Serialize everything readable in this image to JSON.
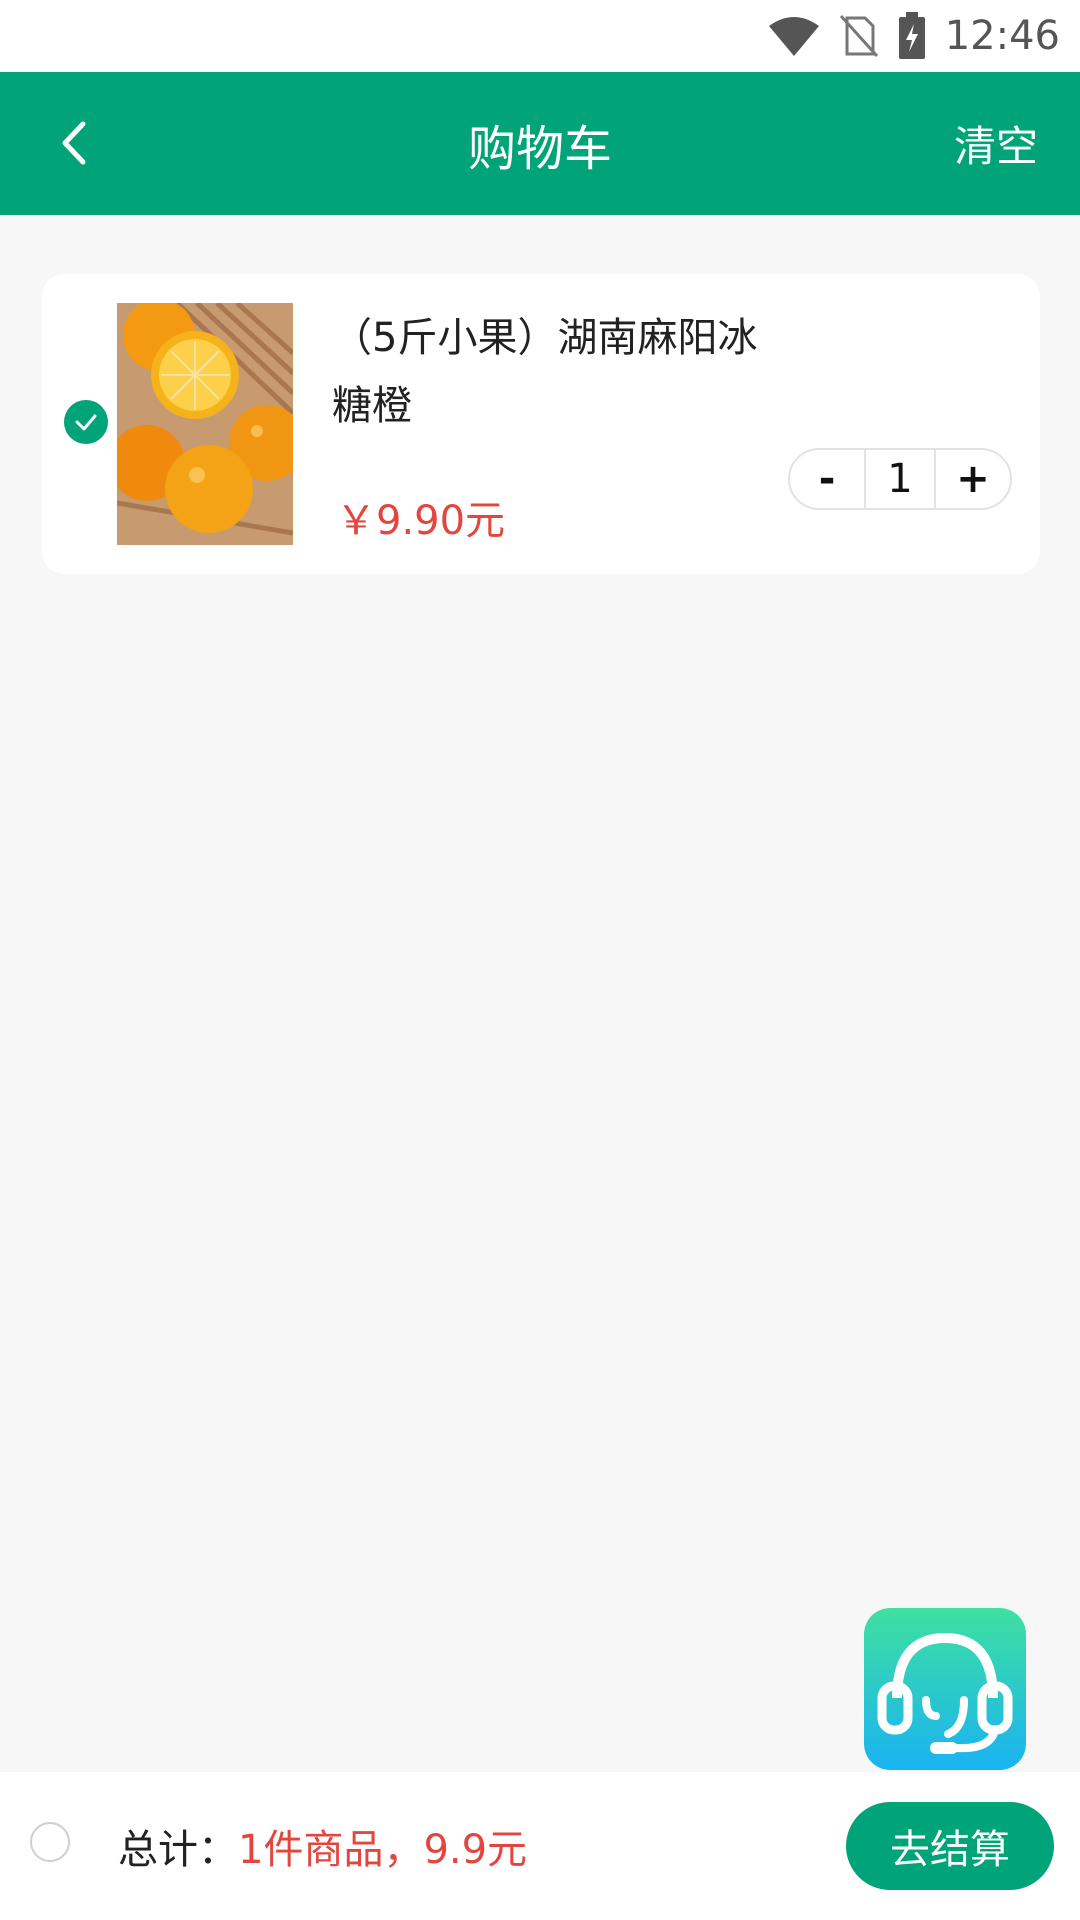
{
  "status_bar": {
    "time": "12:46"
  },
  "header": {
    "title": "购物车",
    "clear_label": "清空"
  },
  "cart": {
    "items": [
      {
        "name": "（5斤小果）湖南麻阳冰糖橙",
        "price": "￥9.90元",
        "quantity": "1",
        "selected": true,
        "minus_label": "-",
        "plus_label": "+"
      }
    ]
  },
  "footer": {
    "total_label": "总计：",
    "total_value": "1件商品，9.9元",
    "checkout_label": "去结算"
  },
  "colors": {
    "brand_green": "#00a478",
    "price_red": "#e2463f"
  },
  "icons": [
    "wifi-icon",
    "no-sim-icon",
    "battery-charging-icon",
    "back-arrow-icon",
    "check-icon",
    "customer-service-icon"
  ]
}
